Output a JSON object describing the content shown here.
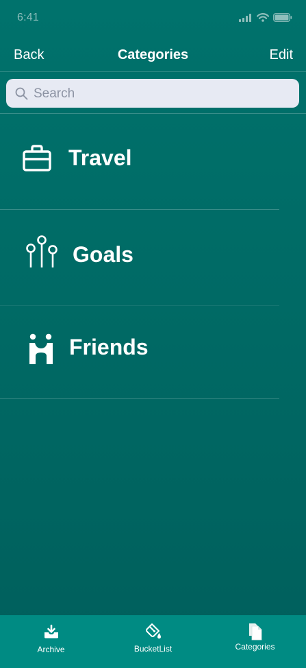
{
  "status_bar": {
    "time": "6:41",
    "icons": [
      "cellular-signal-icon",
      "wifi-icon",
      "battery-icon"
    ]
  },
  "nav": {
    "back_label": "Back",
    "title": "Categories",
    "edit_label": "Edit"
  },
  "search": {
    "placeholder": "Search",
    "value": ""
  },
  "categories": [
    {
      "label": "Travel",
      "icon": "briefcase-icon"
    },
    {
      "label": "Goals",
      "icon": "pins-icon"
    },
    {
      "label": "Friends",
      "icon": "friends-icon"
    }
  ],
  "tab_bar": {
    "tabs": [
      {
        "label": "Archive",
        "icon": "archive-download-icon"
      },
      {
        "label": "BucketList",
        "icon": "paint-bucket-icon"
      },
      {
        "label": "Categories",
        "icon": "copy-documents-icon"
      }
    ],
    "selected": "Categories"
  },
  "colors": {
    "background": "#00726c",
    "tab_bar": "#008b83",
    "search_field": "#e7eaf3",
    "text": "#ffffff"
  }
}
